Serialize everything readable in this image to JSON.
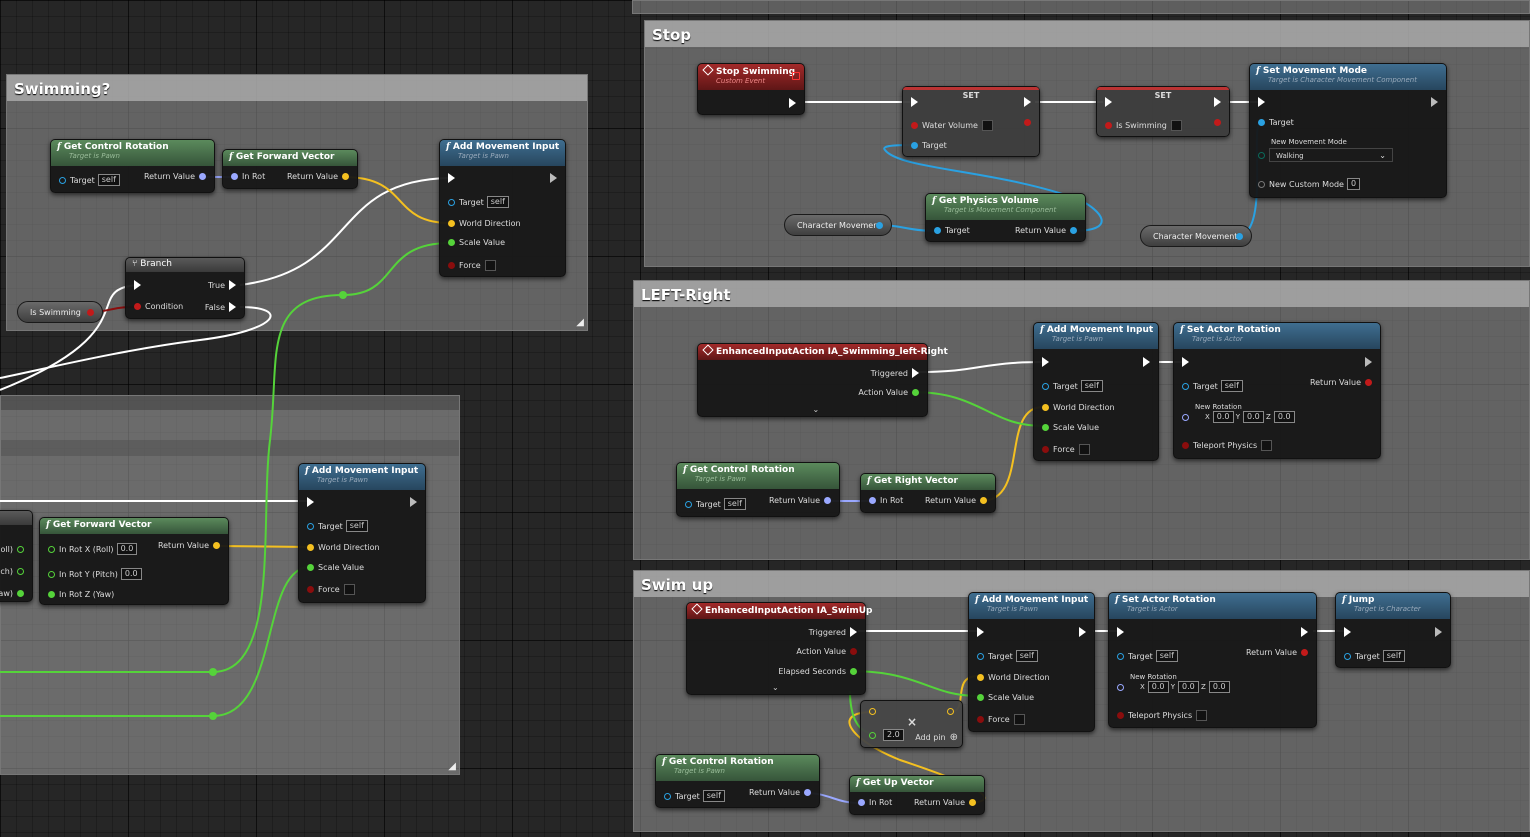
{
  "comments": {
    "swimming": "Swimming?",
    "stop": "Stop",
    "left_right": "LEFT-Right",
    "swim_up": "Swim up"
  },
  "nodes": {
    "get_control_rotation_1": {
      "title": "Get Control Rotation",
      "sub": "Target is Pawn",
      "target": "Target",
      "self": "self",
      "ret": "Return Value"
    },
    "get_forward_vector_1": {
      "title": "Get Forward Vector",
      "in_rot": "In Rot",
      "ret": "Return Value"
    },
    "add_movement_input_1": {
      "title": "Add Movement Input",
      "sub": "Target is Pawn",
      "target": "Target",
      "self": "self",
      "world_dir": "World Direction",
      "scale": "Scale Value",
      "force": "Force"
    },
    "branch": {
      "title": "Branch",
      "cond": "Condition",
      "true_lbl": "True",
      "false_lbl": "False"
    },
    "is_swimming_getter": "Is Swimming",
    "get_forward_vector_2": {
      "title": "Get Forward Vector",
      "x": "In Rot X (Roll)",
      "y": "In Rot Y (Pitch)",
      "z": "In Rot Z (Yaw)",
      "ret": "Return Value",
      "v0": "0.0",
      "v1": "0.0"
    },
    "partial_pins": [
      "oll)",
      "ch)",
      "aw)"
    ],
    "add_movement_input_2": {
      "title": "Add Movement Input",
      "sub": "Target is Pawn",
      "target": "Target",
      "self": "self",
      "world_dir": "World Direction",
      "scale": "Scale Value",
      "force": "Force"
    },
    "stop_swimming": {
      "title": "Stop Swimming",
      "sub": "Custom Event"
    },
    "set_1": {
      "title": "SET",
      "var": "Water Volume",
      "target": "Target"
    },
    "set_2": {
      "title": "SET",
      "var": "Is Swimming"
    },
    "set_movement_mode": {
      "title": "Set Movement Mode",
      "sub": "Target is Character Movement Component",
      "target": "Target",
      "mode_lbl": "New Movement Mode",
      "mode_val": "Walking",
      "custom_lbl": "New Custom Mode",
      "custom_val": "0"
    },
    "char_movement_1": "Character Movement",
    "get_physics_volume": {
      "title": "Get Physics Volume",
      "sub": "Target is Movement Component",
      "target": "Target",
      "ret": "Return Value"
    },
    "char_movement_2": "Character Movement",
    "ia_left_right": {
      "title": "EnhancedInputAction IA_Swimming_left-Right",
      "triggered": "Triggered",
      "action_value": "Action Value"
    },
    "add_movement_input_3": {
      "title": "Add Movement Input",
      "sub": "Target is Pawn",
      "target": "Target",
      "self": "self",
      "world_dir": "World Direction",
      "scale": "Scale Value",
      "force": "Force"
    },
    "set_actor_rotation_1": {
      "title": "Set Actor Rotation",
      "sub": "Target is Actor",
      "target": "Target",
      "self": "self",
      "ret": "Return Value",
      "new_rot": "New Rotation",
      "x": "X",
      "y": "Y",
      "z": "Z",
      "xv": "0.0",
      "yv": "0.0",
      "zv": "0.0",
      "teleport": "Teleport Physics"
    },
    "get_control_rotation_2": {
      "title": "Get Control Rotation",
      "sub": "Target is Pawn",
      "target": "Target",
      "self": "self",
      "ret": "Return Value"
    },
    "get_right_vector": {
      "title": "Get Right Vector",
      "in_rot": "In Rot",
      "ret": "Return Value"
    },
    "ia_swimup": {
      "title": "EnhancedInputAction IA_SwimUp",
      "triggered": "Triggered",
      "action_value": "Action Value",
      "elapsed": "Elapsed Seconds"
    },
    "add_movement_input_4": {
      "title": "Add Movement Input",
      "sub": "Target is Pawn",
      "target": "Target",
      "self": "self",
      "world_dir": "World Direction",
      "scale": "Scale Value",
      "force": "Force"
    },
    "set_actor_rotation_2": {
      "title": "Set Actor Rotation",
      "sub": "Target is Actor",
      "target": "Target",
      "self": "self",
      "ret": "Return Value",
      "new_rot": "New Rotation",
      "x": "X",
      "y": "Y",
      "z": "Z",
      "xv": "0.0",
      "yv": "0.0",
      "zv": "0.0",
      "teleport": "Teleport Physics"
    },
    "jump": {
      "title": "Jump",
      "sub": "Target is Character",
      "target": "Target",
      "self": "self"
    },
    "multiply": {
      "op": "×",
      "value": "2.0",
      "add_pin": "Add pin"
    },
    "get_control_rotation_3": {
      "title": "Get Control Rotation",
      "sub": "Target is Pawn",
      "target": "Target",
      "self": "self",
      "ret": "Return Value"
    },
    "get_up_vector": {
      "title": "Get Up Vector",
      "in_rot": "In Rot",
      "ret": "Return Value"
    }
  },
  "colors": {
    "exec_wire": "#ffffff",
    "float_wire": "#55d33a",
    "vector_wire": "#f4c020",
    "object_wire": "#2aa1e2",
    "rotator_wire": "#9aa8ff",
    "bool_wire": "#8a0d0d"
  }
}
